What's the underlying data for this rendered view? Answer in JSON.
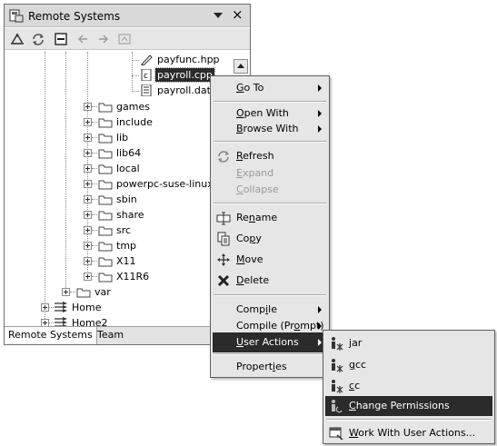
{
  "view": {
    "title": "Remote Systems",
    "close_glyph": "×",
    "toolbar_icons": [
      "remote-connection-icon",
      "refresh-icon",
      "collapse-all-icon",
      "back-arrow-icon",
      "forward-arrow-icon",
      "home-icon"
    ]
  },
  "tree": {
    "files": [
      {
        "label": "payfunc.hpp",
        "icon": "edit-file-icon"
      },
      {
        "label": "payroll.cpp",
        "icon": "c-source-file-icon",
        "selected": true
      },
      {
        "label": "payroll.dat",
        "icon": "text-file-icon"
      }
    ],
    "folders": [
      "games",
      "include",
      "lib",
      "lib64",
      "local",
      "powerpc-suse-linux",
      "sbin",
      "share",
      "src",
      "tmp",
      "X11",
      "X11R6"
    ],
    "var_folder": "var",
    "filters": [
      "Home",
      "Home2"
    ]
  },
  "tabs": [
    "Remote Systems",
    "Team"
  ],
  "context_menu": {
    "items": [
      {
        "label": "Go To",
        "mnemonic_index": 0,
        "submenu": true
      },
      {
        "label": "Open With",
        "mnemonic_index": 0,
        "submenu": true
      },
      {
        "label": "Browse With",
        "mnemonic_index": 0,
        "submenu": true
      },
      {
        "label": "Refresh",
        "mnemonic_index": 0,
        "icon": "refresh-icon"
      },
      {
        "label": "Expand",
        "mnemonic_index": 0,
        "disabled": true
      },
      {
        "label": "Collapse",
        "mnemonic_index": 0,
        "disabled": true
      },
      {
        "label": "Rename",
        "mnemonic_index": 2,
        "icon": "rename-icon"
      },
      {
        "label": "Copy",
        "mnemonic_index": 2,
        "icon": "copy-icon"
      },
      {
        "label": "Move",
        "mnemonic_index": 0,
        "icon": "move-icon"
      },
      {
        "label": "Delete",
        "mnemonic_index": 0,
        "icon": "delete-icon"
      },
      {
        "label": "Compile",
        "mnemonic_index": 4,
        "submenu": true
      },
      {
        "label": "Compile (Prompt)",
        "mnemonic_index": 11,
        "submenu": true
      },
      {
        "label": "User Actions",
        "mnemonic_index": 0,
        "submenu": true,
        "highlighted": true
      },
      {
        "label": "Properties",
        "mnemonic_index": 7
      }
    ]
  },
  "user_actions_menu": {
    "items": [
      {
        "label": "jar",
        "mnemonic_index": 0,
        "icon": "user-action-icon"
      },
      {
        "label": "gcc",
        "mnemonic_index": 0,
        "icon": "user-action-icon"
      },
      {
        "label": "cc",
        "mnemonic_index": 0,
        "icon": "user-action-icon"
      },
      {
        "label": "Change Permissions",
        "mnemonic_index": 0,
        "icon": "user-action-icon",
        "highlighted": true
      },
      {
        "label": "Work With User Actions...",
        "mnemonic_index": 0,
        "icon": "work-with-actions-icon"
      }
    ]
  },
  "colors": {
    "highlight": "#2b2b2b",
    "menu_background": "#e6e6e6",
    "titlebar": "#d9d9d9",
    "disabled_text": "#9a9a9a"
  }
}
